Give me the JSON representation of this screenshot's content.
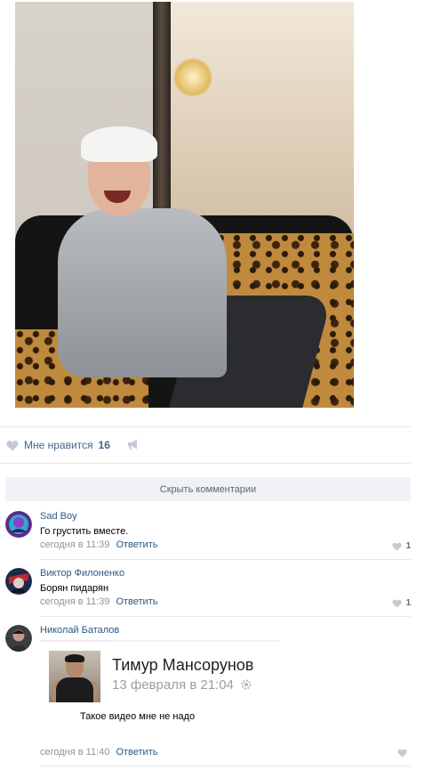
{
  "post": {
    "likes_label": "Мне нравится",
    "likes_count": "16"
  },
  "hide_comments_label": "Скрыть комментарии",
  "comments": [
    {
      "author": "Sad Boy",
      "text": "Го грустить вместе.",
      "time": "сегодня в 11:39",
      "reply": "Ответить",
      "likes": "1"
    },
    {
      "author": "Виктор Филоненко",
      "text": "Борян пидарян",
      "time": "сегодня в 11:39",
      "reply": "Ответить",
      "likes": "1"
    },
    {
      "author": "Николай Баталов",
      "attachment": {
        "name": "Тимур Мансорунов",
        "date": "13 февраля в 21:04",
        "text": "Такое видео мне не надо"
      },
      "time": "сегодня в 11:40",
      "reply": "Ответить"
    }
  ],
  "colors": {
    "link": "#2a5885",
    "meta": "#939393",
    "icon": "#c1cbd6",
    "button_bg": "#f0f2f5"
  }
}
